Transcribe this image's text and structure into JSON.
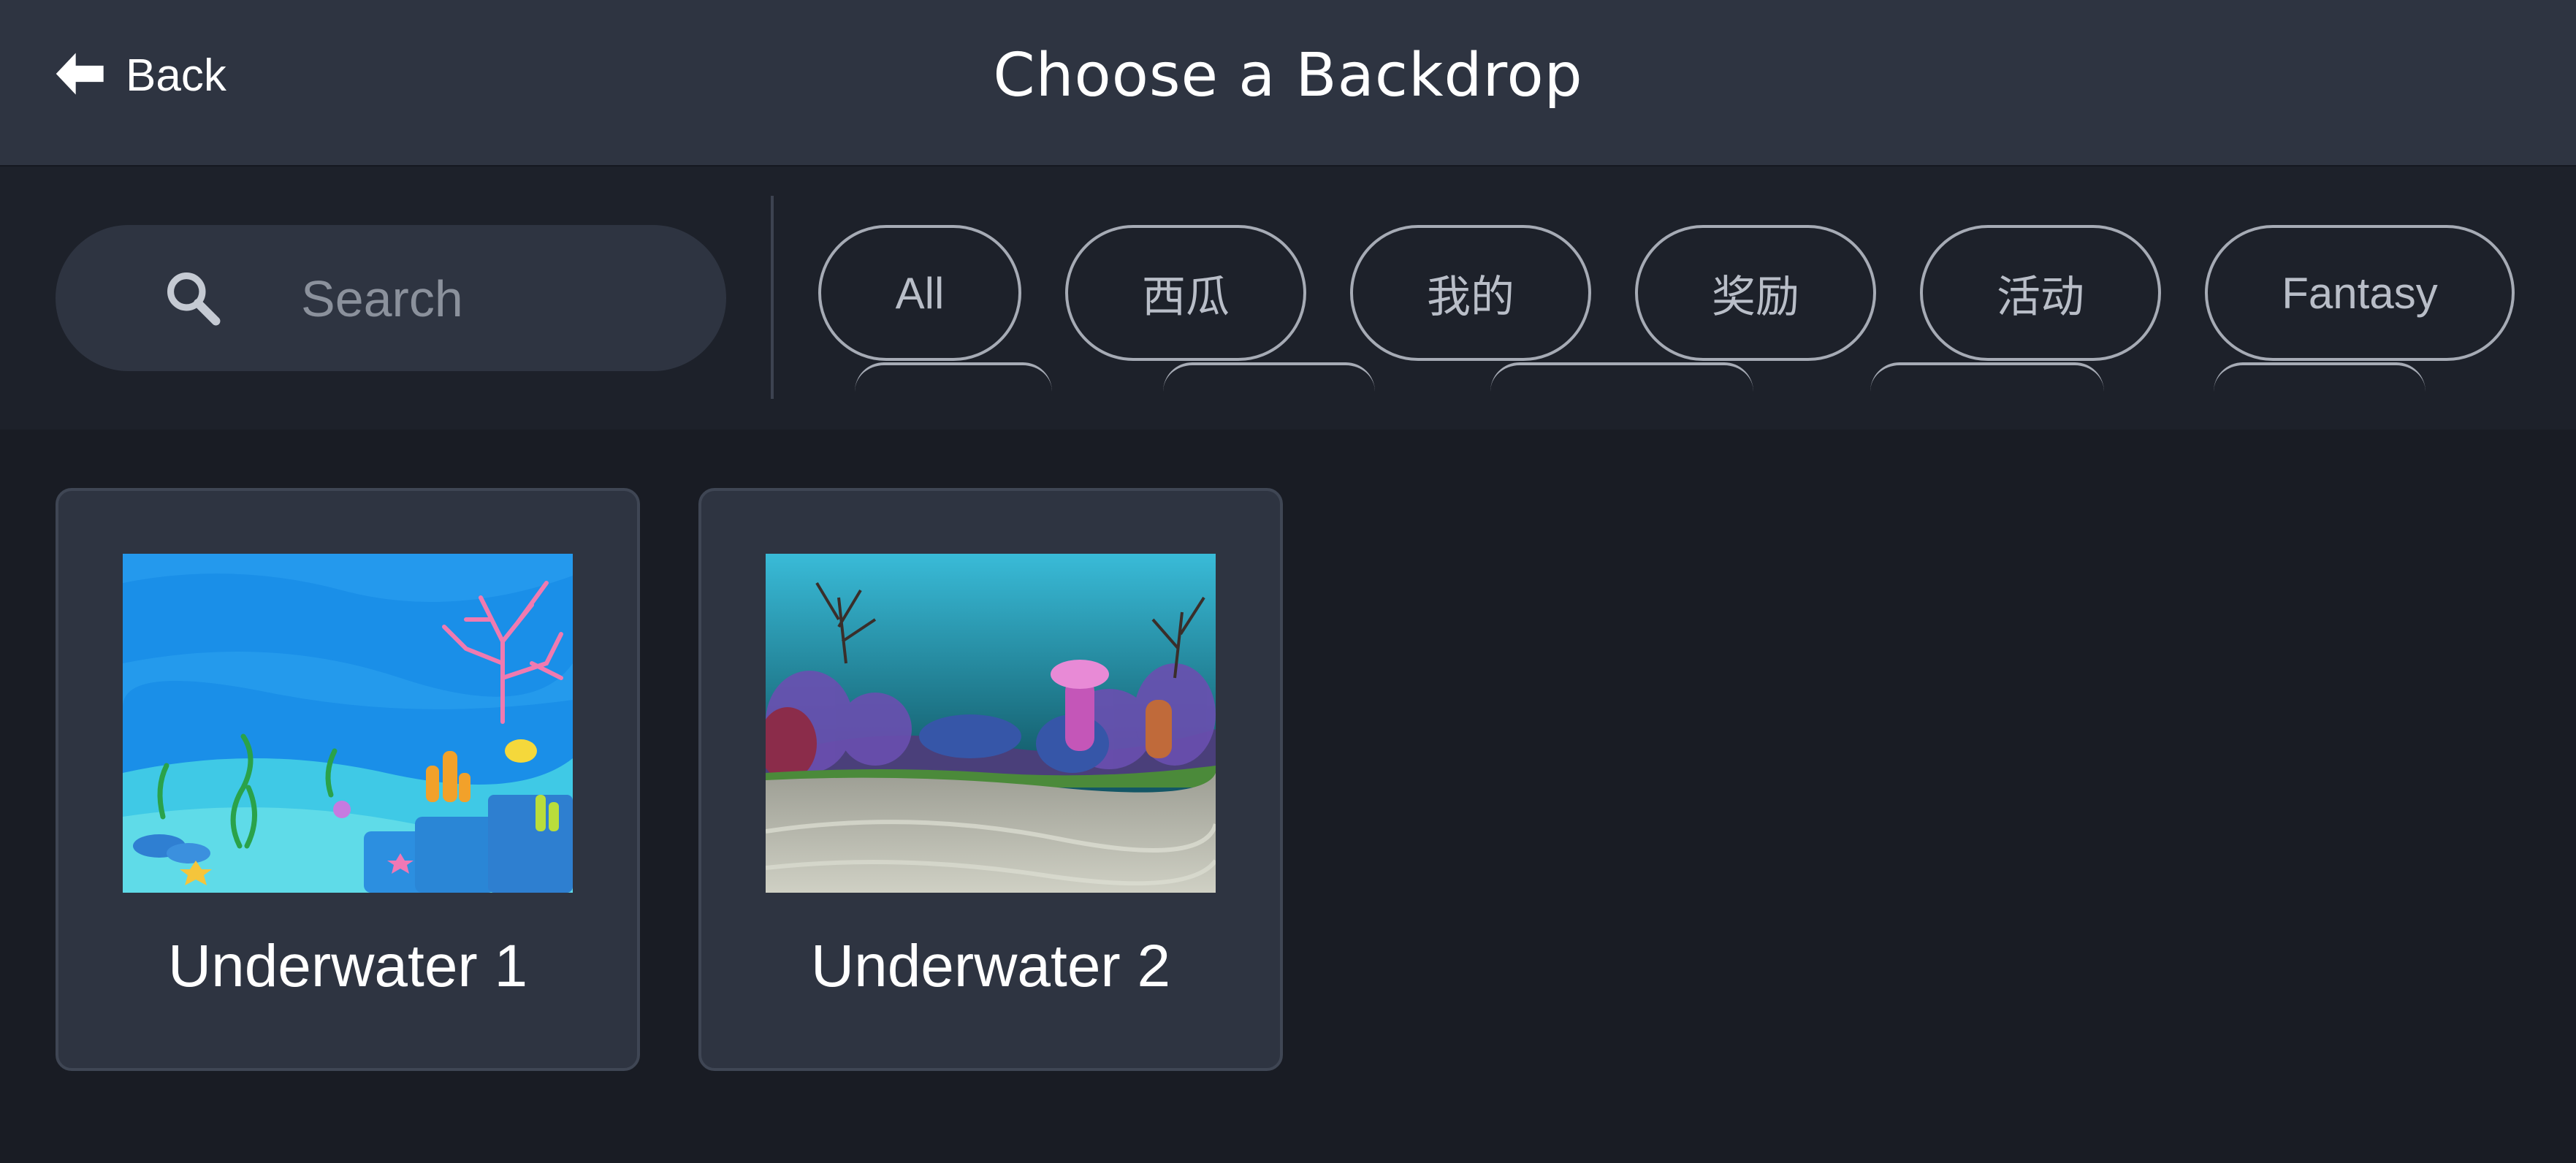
{
  "header": {
    "back_label": "Back",
    "title": "Choose a Backdrop"
  },
  "search": {
    "placeholder": "Search"
  },
  "tags": [
    {
      "label": "All"
    },
    {
      "label": "西瓜"
    },
    {
      "label": "我的"
    },
    {
      "label": "奖励"
    },
    {
      "label": "活动"
    },
    {
      "label": "Fantasy"
    }
  ],
  "backdrops": [
    {
      "name": "Underwater 1"
    },
    {
      "name": "Underwater 2"
    }
  ],
  "colors": {
    "header_bg": "#2e3441",
    "page_bg": "#191c24",
    "card_bg": "#2e3441",
    "tag_border": "#a6abb5"
  },
  "icons": {
    "back": "back-arrow-icon",
    "search": "search-icon"
  }
}
